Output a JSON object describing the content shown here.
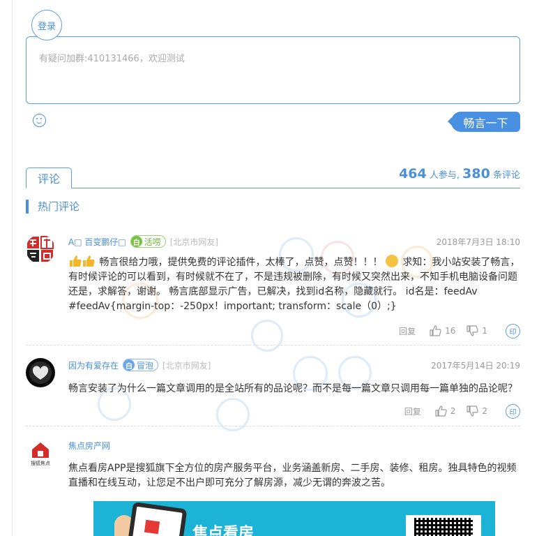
{
  "header": {
    "login_label": "登录"
  },
  "composer": {
    "placeholder": "有疑问加群:410131466，欢迎测试",
    "submit_label": "畅言一下"
  },
  "tabs": {
    "active_label": "评论"
  },
  "stats": {
    "participants": "464",
    "participants_suffix": "人参与,",
    "comments": "380",
    "comments_suffix": "条评论"
  },
  "hot_section": {
    "title": "热门评论"
  },
  "comments": [
    {
      "username": "A□ 百变鹏仔□",
      "badge_icon": "白",
      "badge_label": "活唠",
      "location": "[北京市网友]",
      "time": "2018年7月3日 18:10",
      "text_before": "畅言很给力哦，提供免费的评论插件，太棒了，点赞，点赞！！！",
      "text_after": "求知：我小站安装了畅言，有时候评论的可以看到，有时候就不在了，不是违规被删除，有时候又突然出来，不知手机电脑设备问题还是，求解答，谢谢。 畅言底部显示广告，已解决，找到id名称，隐藏就行。 id名是：feedAv #feedAv{margin-top：-250px！important; transform：scale（0）;}",
      "reply_label": "回复",
      "likes": "16",
      "dislikes": "1",
      "share_label": "印"
    },
    {
      "username": "因为有爱存在",
      "badge_icon": "白",
      "badge_label": "冒泡",
      "location": "[北京市网友]",
      "time": "2017年5月14日 20:19",
      "text_before": "畅言安装了为什么一篇文章调用的是全站所有的品论呢？而不是每一篇文章只调用每一篇单独的品论呢？",
      "reply_label": "回复",
      "likes": "2",
      "dislikes": "2",
      "share_label": "印"
    }
  ],
  "ad": {
    "source": "焦点房产网",
    "avatar_text": "搜狐焦点",
    "text": "焦点看房APP是搜狐旗下全方位的房产服务平台，业务涵盖新房、二手房、装修、租房。独具特色的视频直播和在线互动，让您足不出户即可充分了解房源，减少无谓的奔波之苦。",
    "banner_title": "焦点看房"
  },
  "colors": {
    "accent": "#4a90d9",
    "button": "#4a90e2",
    "badge_green": "#77c043"
  }
}
